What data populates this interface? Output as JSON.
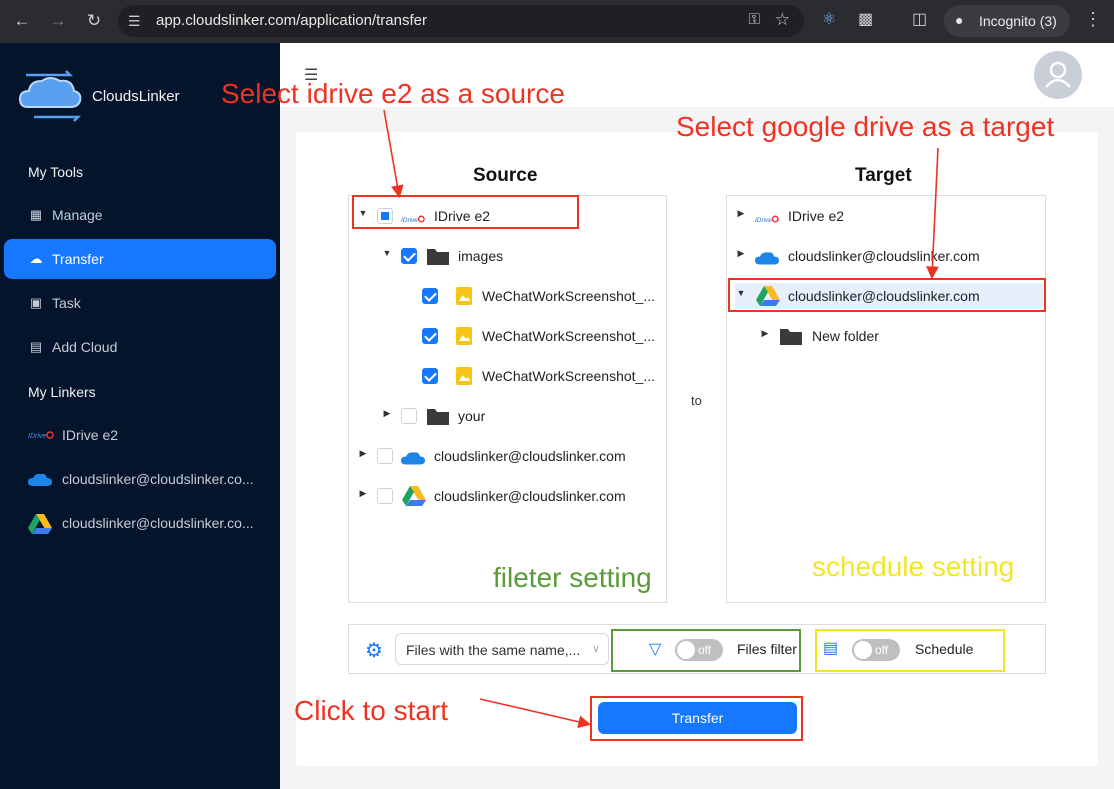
{
  "browser": {
    "url": "app.cloudslinker.com/application/transfer",
    "incognito_label": "Incognito (3)"
  },
  "sidebar": {
    "brand": "CloudsLinker",
    "my_tools_title": "My Tools",
    "my_linkers_title": "My Linkers",
    "tools": [
      {
        "label": "Manage",
        "icon": "grid-icon"
      },
      {
        "label": "Transfer",
        "icon": "cloud-upload-icon",
        "active": true
      },
      {
        "label": "Task",
        "icon": "calendar-icon"
      },
      {
        "label": "Add Cloud",
        "icon": "add-cloud-icon"
      }
    ],
    "linkers": [
      {
        "label": "IDrive e2",
        "icon": "idrive-logo-icon"
      },
      {
        "label": "cloudslinker@cloudslinker.co...",
        "icon": "onedrive-icon"
      },
      {
        "label": "cloudslinker@cloudslinker.co...",
        "icon": "google-drive-icon"
      }
    ]
  },
  "source": {
    "title": "Source",
    "nodes": [
      {
        "label": "IDrive e2",
        "icon": "idrive-logo-icon"
      },
      {
        "label": "images",
        "icon": "folder-icon"
      },
      {
        "label": "WeChatWorkScreenshot_...",
        "icon": "image-file-icon"
      },
      {
        "label": "WeChatWorkScreenshot_...",
        "icon": "image-file-icon"
      },
      {
        "label": "WeChatWorkScreenshot_...",
        "icon": "image-file-icon"
      },
      {
        "label": "your",
        "icon": "folder-icon"
      },
      {
        "label": "cloudslinker@cloudslinker.com",
        "icon": "onedrive-icon"
      },
      {
        "label": "cloudslinker@cloudslinker.com",
        "icon": "google-drive-icon"
      }
    ]
  },
  "to_label": "to",
  "target": {
    "title": "Target",
    "nodes": [
      {
        "label": "IDrive e2",
        "icon": "idrive-logo-icon"
      },
      {
        "label": "cloudslinker@cloudslinker.com",
        "icon": "onedrive-icon"
      },
      {
        "label": "cloudslinker@cloudslinker.com",
        "icon": "google-drive-icon"
      },
      {
        "label": "New folder",
        "icon": "folder-icon"
      }
    ]
  },
  "settings": {
    "conflict_select": "Files with the same name,...",
    "files_filter_label": "Files filter",
    "files_filter_state": "off",
    "schedule_label": "Schedule",
    "schedule_state": "off"
  },
  "transfer_button": "Transfer",
  "annotations": {
    "source_note": "Select idrive e2 as a source",
    "target_note": "Select google drive as a target",
    "filter_note": "fileter setting",
    "schedule_note": "schedule setting",
    "start_note": "Click to start",
    "colors": {
      "red": "#ee3322",
      "green": "#5a9a3a",
      "yellow": "#f2e52a"
    }
  },
  "colors": {
    "primary": "#1677ff",
    "sidebar_bg": "#04142a"
  }
}
